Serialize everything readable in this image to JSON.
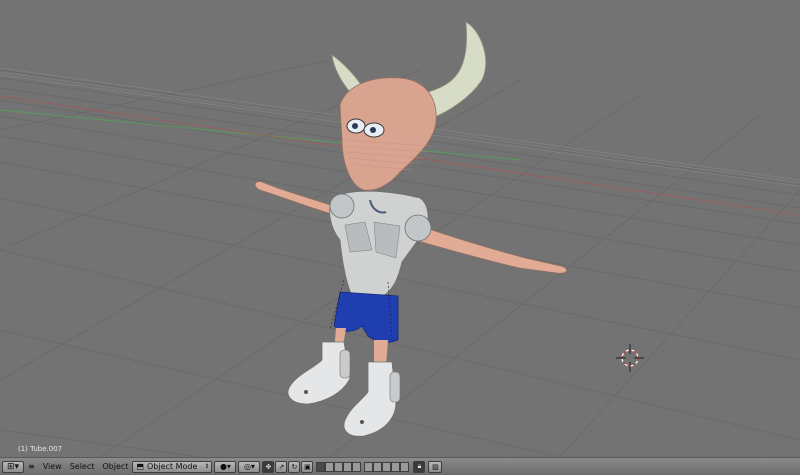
{
  "viewport": {
    "object_label": "(1) Tube.007"
  },
  "header": {
    "editor_icon": "grid-icon",
    "menus": [
      "View",
      "Select",
      "Object"
    ],
    "mode_label": "Object Mode",
    "shading_icon": "sphere-icon",
    "pivot_icon": "pivot-icon",
    "manipulator_icon": "transform-icon",
    "lock_icon": "lock-icon",
    "render_icon": "image-icon"
  },
  "colors": {
    "viewport_bg": "#737373",
    "grid_line": "#6a6a6a",
    "x_axis": "#a05050",
    "y_axis": "#5a9a5a"
  }
}
